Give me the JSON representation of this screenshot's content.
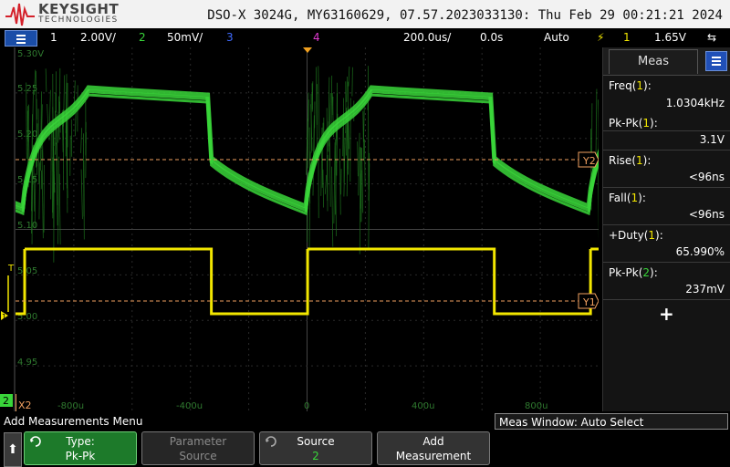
{
  "header": {
    "brand": "KEYSIGHT",
    "brand_sub": "TECHNOLOGIES",
    "title": "DSO-X 3024G, MY63160629, 07.57.2023033130: Thu Feb 29 00:21:21 2024"
  },
  "status_bar": {
    "ch1_num": "1",
    "ch1_scale": "2.00V/",
    "ch2_num": "2",
    "ch2_scale": "50mV/",
    "ch3_num": "3",
    "ch4_num": "4",
    "timebase": "200.0us/",
    "delay": "0.0s",
    "trigger_mode": "Auto",
    "trigger_source": "1",
    "trigger_level": "1.65V"
  },
  "graticule": {
    "y_labels": [
      "5.30V",
      "5.25",
      "5.20",
      "5.15",
      "5.10",
      "5.05",
      "5.00",
      "4.95"
    ],
    "x_labels": [
      "-800u",
      "-400u",
      "0",
      "400u",
      "800u"
    ],
    "cursor_y1": "Y1",
    "cursor_y2": "Y2",
    "cursor_x2": "X2",
    "trigger_marker": "T",
    "ch1_ground": "1",
    "ch2_marker": "2"
  },
  "colors": {
    "ch1": "#f2e600",
    "ch2": "#39d63a",
    "ch3": "#3f6bff",
    "ch4": "#e03bd0",
    "cursor": "#f0a060"
  },
  "measurements": {
    "tab": "Meas",
    "items": [
      {
        "label": "Freq",
        "ch": "1",
        "value": "1.0304kHz"
      },
      {
        "label": "Pk-Pk",
        "ch": "1",
        "value": "3.1V"
      },
      {
        "label": "Rise",
        "ch": "1",
        "value": "<96ns"
      },
      {
        "label": "Fall",
        "ch": "1",
        "value": "<96ns"
      },
      {
        "label": "+Duty",
        "ch": "1",
        "value": "65.990%"
      },
      {
        "label": "Pk-Pk",
        "ch": "2",
        "value": "237mV"
      }
    ],
    "add_symbol": "+"
  },
  "bottom": {
    "menu_title": "Add Measurements Menu",
    "meas_window": "Meas Window: Auto Select"
  },
  "softkeys": [
    {
      "line1": "Type:",
      "line2": "Pk-Pk"
    },
    {
      "line1": "Parameter",
      "line2": "Source"
    },
    {
      "line1": "Source",
      "line2": "2"
    },
    {
      "line1": "Add",
      "line2": "Measurement"
    }
  ],
  "scope": {
    "timebase_us_per_div": 200,
    "ch1": {
      "type": "square",
      "frequency_khz": 1.0304,
      "duty_percent": 65.99,
      "high_v": 3.1,
      "low_v": 0.0
    },
    "ch2": {
      "type": "noisy square",
      "center_v": 5.16,
      "pk_pk_mv": 237
    }
  }
}
